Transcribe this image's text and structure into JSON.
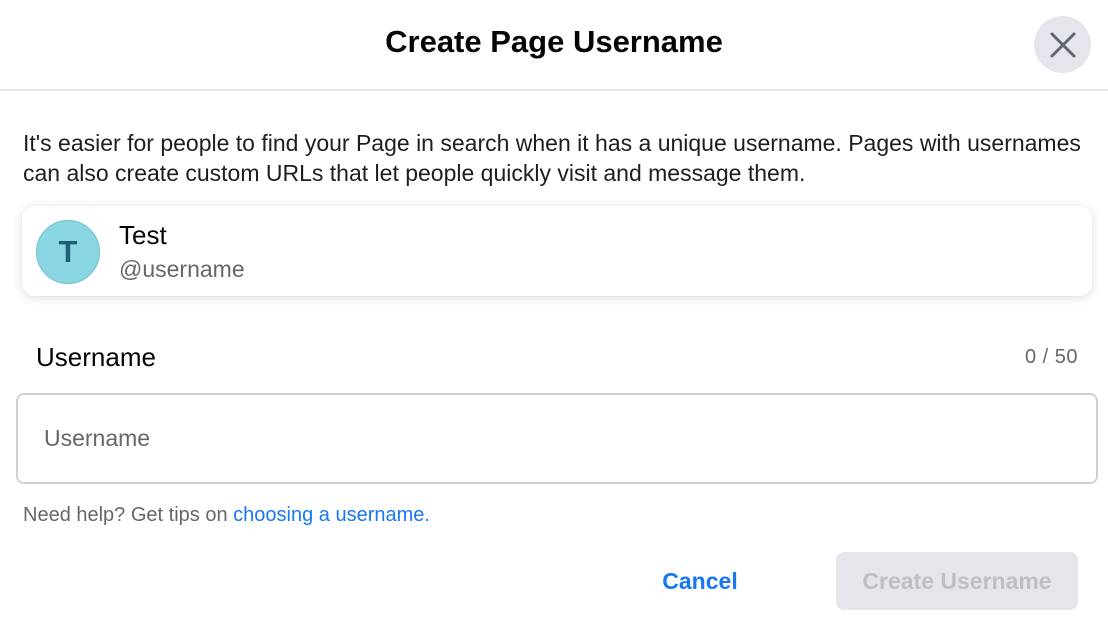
{
  "dialog": {
    "title": "Create Page Username",
    "close_icon": "close-icon"
  },
  "description": "It's easier for people to find your Page in search when it has a unique username. Pages with usernames can also create custom URLs that let people quickly visit and message them.",
  "page_card": {
    "avatar_letter": "T",
    "name": "Test",
    "handle": "@username"
  },
  "username_field": {
    "label": "Username",
    "char_count": "0 / 50",
    "value": "",
    "placeholder": "Username"
  },
  "help": {
    "prefix": "Need help? Get tips on",
    "link_text": "choosing a username."
  },
  "actions": {
    "cancel_label": "Cancel",
    "create_label": "Create Username"
  },
  "colors": {
    "accent": "#1877f2",
    "avatar_bg": "#8ad6e3",
    "disabled_bg": "#e4e6eb",
    "disabled_text": "#bcc0c4"
  }
}
